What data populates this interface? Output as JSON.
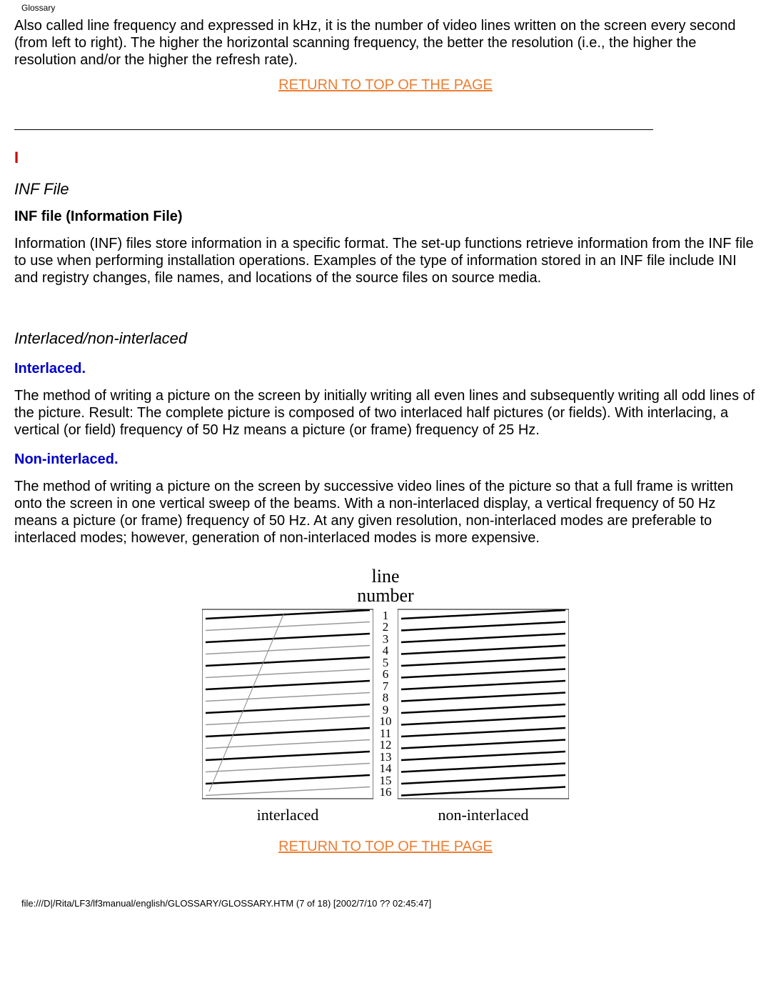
{
  "header": {
    "breadcrumb": "Glossary"
  },
  "intro": {
    "para1": "Also called line frequency and expressed in kHz, it is the number of video lines written on the screen every second (from left to right). The higher the horizontal scanning frequency, the better the resolution (i.e., the higher the resolution and/or the higher the refresh rate).",
    "return_link": "RETURN TO TOP OF THE PAGE"
  },
  "section_letter": "I",
  "inf": {
    "heading": "INF File",
    "sub": "INF file (Information File)",
    "para": "Information (INF) files store information in a specific format. The set-up functions retrieve information from the INF file to use when performing installation operations. Examples of the type of information stored in an INF file include INI and registry changes, file names, and locations of the source files on source media."
  },
  "interlaced": {
    "heading": "Interlaced/non-interlaced",
    "sub1": "Interlaced.",
    "para1": "The method of writing a picture on the screen by initially writing all even lines and subsequently writing all odd lines of the picture. Result: The complete picture is composed of two interlaced half pictures (or fields). With interlacing, a vertical (or field) frequency of 50 Hz means a picture (or frame) frequency of 25 Hz.",
    "sub2": "Non-interlaced.",
    "para2": "The method of writing a picture on the screen by successive video lines of the picture so that a full frame is written onto the screen in one vertical sweep of the beams. With a non-interlaced display, a vertical frequency of 50 Hz means a picture (or frame) frequency of 50 Hz. At any given resolution, non-interlaced modes are preferable to interlaced modes; however, generation of non-interlaced modes is more expensive."
  },
  "diagram": {
    "title_line1": "line",
    "title_line2": "number",
    "numbers": [
      "1",
      "2",
      "3",
      "4",
      "5",
      "6",
      "7",
      "8",
      "9",
      "10",
      "11",
      "12",
      "13",
      "14",
      "15",
      "16"
    ],
    "caption_left": "interlaced",
    "caption_right": "non-interlaced"
  },
  "return_link2": "RETURN TO TOP OF THE PAGE",
  "footer": {
    "path": "file:///D|/Rita/LF3/lf3manual/english/GLOSSARY/GLOSSARY.HTM (7 of 18) [2002/7/10 ?? 02:45:47]"
  },
  "chart_data": {
    "type": "diagram",
    "description": "Two side-by-side schematics of scan-line ordering for a 16-line raster. Left panel (interlaced): first field scans odd lines 1,3,5,7,9,11,13,15 then retraces to top and second field scans even lines 2,4,6,8,10,12,14,16. Right panel (non-interlaced): lines scanned sequentially 1 through 16 in one pass.",
    "line_count": 16,
    "interlaced_first_field": [
      1,
      3,
      5,
      7,
      9,
      11,
      13,
      15
    ],
    "interlaced_second_field": [
      2,
      4,
      6,
      8,
      10,
      12,
      14,
      16
    ],
    "non_interlaced_order": [
      1,
      2,
      3,
      4,
      5,
      6,
      7,
      8,
      9,
      10,
      11,
      12,
      13,
      14,
      15,
      16
    ],
    "caption_left": "interlaced",
    "caption_right": "non-interlaced",
    "title": "line number"
  }
}
